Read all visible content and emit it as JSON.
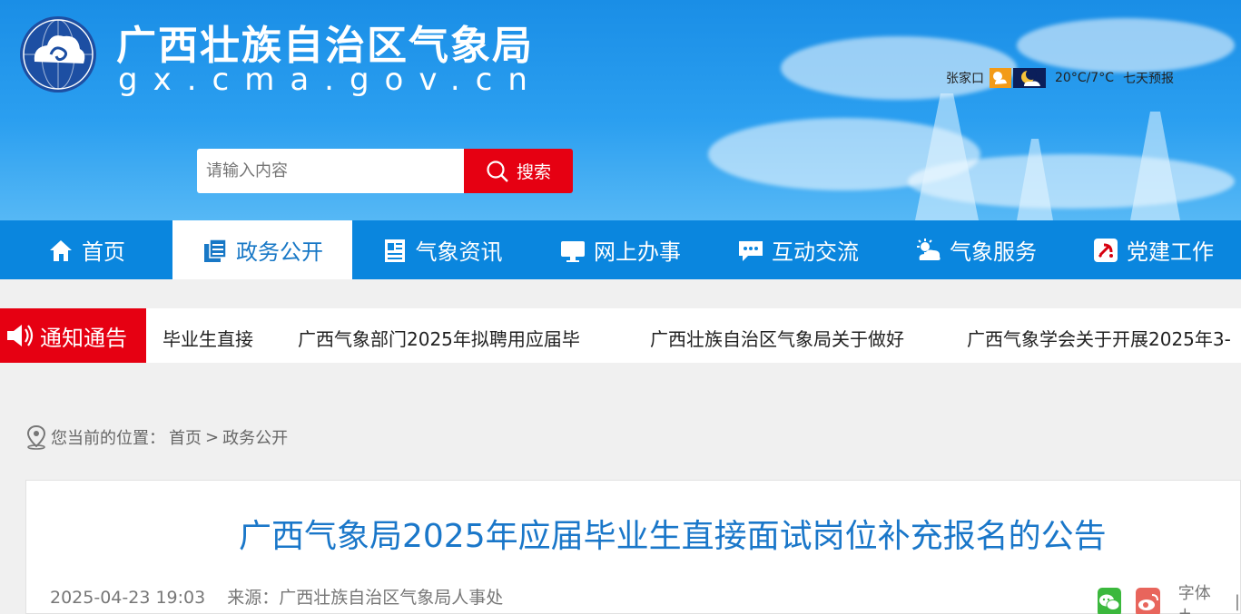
{
  "header": {
    "title": "广西壮族自治区气象局",
    "url": "gx.cma.gov.cn",
    "weather": {
      "city": "张家口",
      "temp": "20°C/7°C",
      "forecast_link": "七天预报"
    },
    "search": {
      "placeholder": "请输入内容",
      "button_label": "搜索"
    }
  },
  "nav": {
    "items": [
      {
        "label": "首页",
        "icon": "home-icon"
      },
      {
        "label": "政务公开",
        "icon": "document-icon",
        "active": true
      },
      {
        "label": "气象资讯",
        "icon": "newspaper-icon"
      },
      {
        "label": "网上办事",
        "icon": "monitor-icon"
      },
      {
        "label": "互动交流",
        "icon": "chat-icon"
      },
      {
        "label": "气象服务",
        "icon": "weather-icon"
      },
      {
        "label": "党建工作",
        "icon": "party-icon"
      }
    ]
  },
  "notice": {
    "label": "通知通告",
    "items": [
      "毕业生直接",
      "广西气象部门2025年拟聘用应届毕",
      "广西壮族自治区气象局关于做好",
      "广西气象学会关于开展2025年3-"
    ]
  },
  "breadcrumb": {
    "prefix": "您当前的位置：",
    "home": "首页",
    "sep": ">",
    "current": "政务公开"
  },
  "article": {
    "title": "广西气象局2025年应届毕业生直接面试岗位补充报名的公告",
    "date": "2025-04-23 19:03",
    "source": "来源：广西壮族自治区气象局人事处",
    "font_label": "字体+",
    "font_sep": "|"
  },
  "colors": {
    "nav_bg": "#0a86de",
    "accent_red": "#e60012",
    "title_blue": "#1a77c9"
  }
}
